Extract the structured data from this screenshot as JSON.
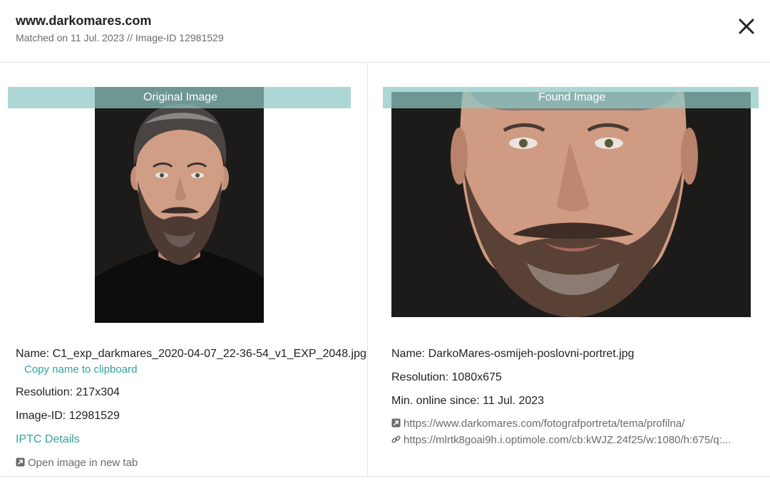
{
  "header": {
    "site": "www.darkomares.com",
    "match_info": "Matched on 11 Jul. 2023 // Image-ID 12981529"
  },
  "original": {
    "banner": "Original Image",
    "name": "Name: C1_exp_darkmares_2020-04-07_22-36-54_v1_EXP_2048.jpg",
    "copy_label": "Copy name to clipboard",
    "resolution": "Resolution: 217x304",
    "image_id": "Image-ID: 12981529",
    "iptc_label": "IPTC Details",
    "open_tab_label": "Open image in new tab"
  },
  "found": {
    "banner": "Found Image",
    "name": "Name: DarkoMares-osmijeh-poslovni-portret.jpg",
    "resolution": "Resolution: 1080x675",
    "online_since": "Min. online since: 11 Jul. 2023",
    "page_url": "https://www.darkomares.com/fotografportreta/tema/profilna/",
    "image_url": "https://mlrtk8goai9h.i.optimole.com/cb:kWJZ.24f25/w:1080/h:675/q:..."
  },
  "icons": {
    "close": "close-icon",
    "open_tab": "external-link-icon",
    "page_link": "external-link-icon",
    "image_link": "chain-link-icon"
  },
  "colors": {
    "accent": "#2fa39b",
    "banner": "#8dc8c4",
    "muted_text": "#6b6b6b",
    "divider": "#e3e6e8"
  }
}
